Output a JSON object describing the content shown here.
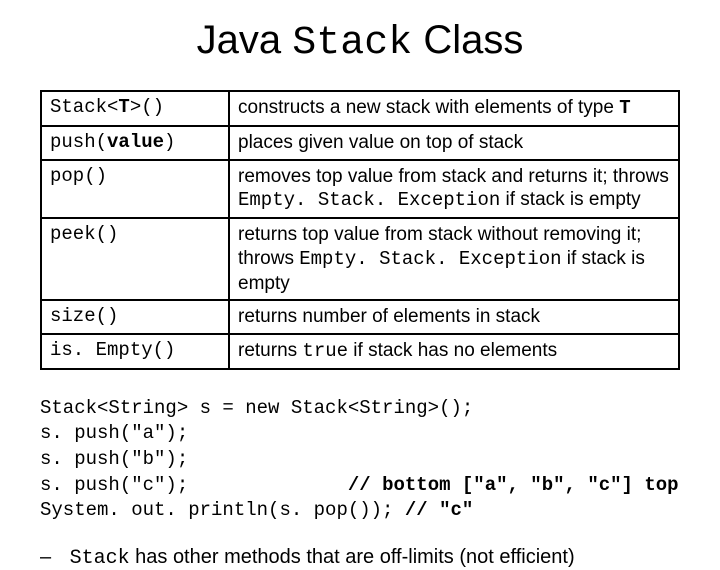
{
  "title": {
    "part1": "Java ",
    "part2_mono": "Stack",
    "part3": " Class"
  },
  "api_rows": [
    {
      "method_pre": "Stack<",
      "method_bold": "T",
      "method_post": ">()",
      "desc_pre": "constructs a new stack with elements of type ",
      "desc_bold_mono": "T",
      "desc_post": ""
    },
    {
      "method_pre": "push(",
      "method_bold": "value",
      "method_post": ")",
      "desc_pre": "places given value on top of stack",
      "desc_bold_mono": "",
      "desc_post": ""
    },
    {
      "method_pre": "pop()",
      "method_bold": "",
      "method_post": "",
      "desc_pre": "removes top value from stack and returns it; throws ",
      "desc_mono": "Empty. Stack. Exception",
      "desc_post": " if stack is empty"
    },
    {
      "method_pre": "peek()",
      "method_bold": "",
      "method_post": "",
      "desc_pre": "returns top value from stack without removing it; throws ",
      "desc_mono": "Empty. Stack. Exception",
      "desc_post": " if stack is empty"
    },
    {
      "method_pre": "size()",
      "method_bold": "",
      "method_post": "",
      "desc_pre": "returns number of elements in stack",
      "desc_mono": "",
      "desc_post": ""
    },
    {
      "method_pre": "is. Empty()",
      "method_bold": "",
      "method_post": "",
      "desc_pre": "returns ",
      "desc_mono": "true",
      "desc_post": " if stack has no elements"
    }
  ],
  "code": {
    "l1": "Stack<String> s = new Stack<String>();",
    "l2": "s. push(\"a\");",
    "l3": "s. push(\"b\");",
    "l4a": "s. push(\"c\");",
    "l4b_pad": "              ",
    "l4c_bold": "// bottom [\"a\", \"b\", \"c\"] top",
    "l5a": "System. out. println(s. pop()); ",
    "l5b_bold": "// \"c\""
  },
  "note": {
    "dash": "–",
    "pre": "",
    "mono": "Stack",
    "post": " has other methods that are off-limits (not efficient)"
  }
}
